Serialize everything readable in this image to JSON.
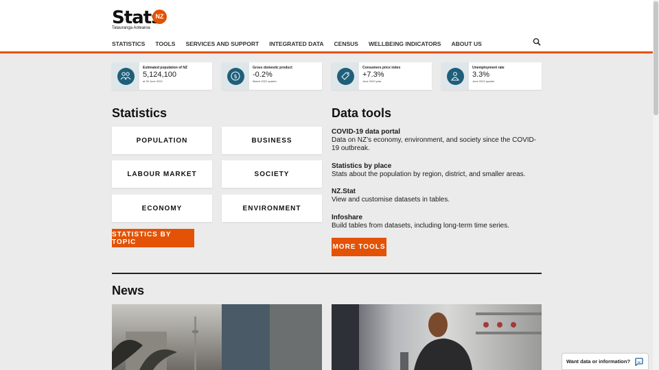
{
  "logo": {
    "word": "Stats",
    "badge": "NZ",
    "tagline": "Tatauranga Aotearoa"
  },
  "nav": [
    "STATISTICS",
    "TOOLS",
    "SERVICES AND SUPPORT",
    "INTEGRATED DATA",
    "CENSUS",
    "WELLBEING INDICATORS",
    "ABOUT US"
  ],
  "kpis": [
    {
      "label": "Estimated population of NZ",
      "value": "5,124,100",
      "sub": "at 30 June 2022",
      "icon": "people-icon"
    },
    {
      "label": "Gross domestic product",
      "value": "-0.2%",
      "sub": "March 2022 quarter",
      "icon": "dollar-icon"
    },
    {
      "label": "Consumers price index",
      "value": "+7.3%",
      "sub": "June 2022 year",
      "icon": "price-tag-icon"
    },
    {
      "label": "Unemployment rate",
      "value": "3.3%",
      "sub": "June 2022 quarter",
      "icon": "person-icon"
    }
  ],
  "statistics": {
    "heading": "Statistics",
    "tiles": [
      "POPULATION",
      "BUSINESS",
      "LABOUR MARKET",
      "SOCIETY",
      "ECONOMY",
      "ENVIRONMENT"
    ],
    "button": "STATISTICS BY TOPIC"
  },
  "data_tools": {
    "heading": "Data tools",
    "items": [
      {
        "title": "COVID-19 data portal",
        "desc": "Data on NZ’s economy, environment, and society since the COVID-19 outbreak."
      },
      {
        "title": "Statistics by place",
        "desc": "Stats about the population by region, district, and smaller areas."
      },
      {
        "title": "NZ.Stat",
        "desc": "View and customise datasets in tables."
      },
      {
        "title": "Infoshare",
        "desc": "Build tables from datasets, including long-term time series."
      }
    ],
    "button": "MORE TOOLS"
  },
  "news": {
    "heading": "News"
  },
  "chat": {
    "label": "Want data or information?"
  },
  "colors": {
    "accent": "#e35205",
    "icon_circle": "#1f5f7a",
    "icon_bg": "#dfe6ea"
  }
}
